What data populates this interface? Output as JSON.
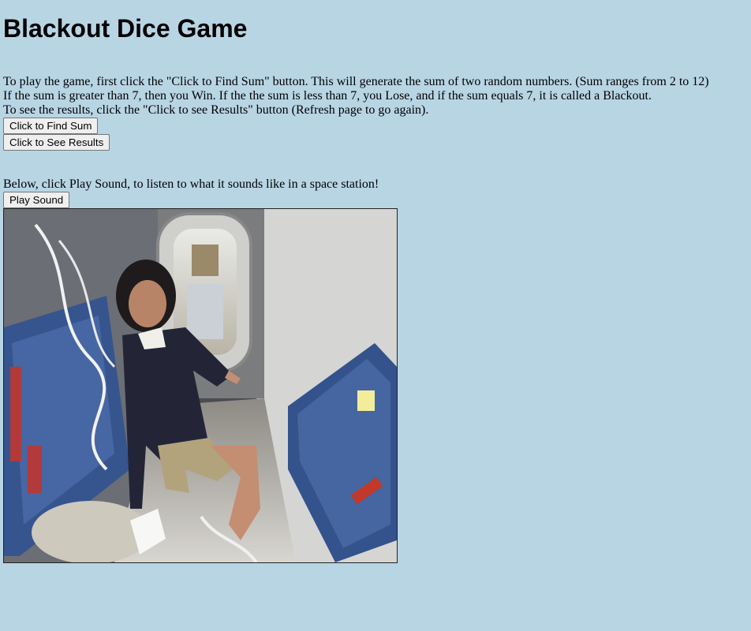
{
  "page": {
    "title": "Blackout Dice Game",
    "instructions": [
      "To play the game, first click the \"Click to Find Sum\" button. This will generate the sum of two random numbers. (Sum ranges from 2 to 12)",
      "If the sum is greater than 7, then you Win. If the the sum is less than 7, you Lose, and if the sum equals 7, it is called a Blackout.",
      "To see the results, click the \"Click to see Results\" button (Refresh page to go again)."
    ],
    "find_sum_button": "Click to Find Sum",
    "see_results_button": "Click to See Results",
    "sound_prompt": "Below, click Play Sound, to listen to what it sounds like in a space station!",
    "play_sound_button": "Play Sound"
  },
  "image": {
    "subject": "astronaut floating inside a space station module"
  },
  "colors": {
    "background": "#b8d5e4",
    "button_face": "#efefef",
    "button_border": "#767676"
  }
}
